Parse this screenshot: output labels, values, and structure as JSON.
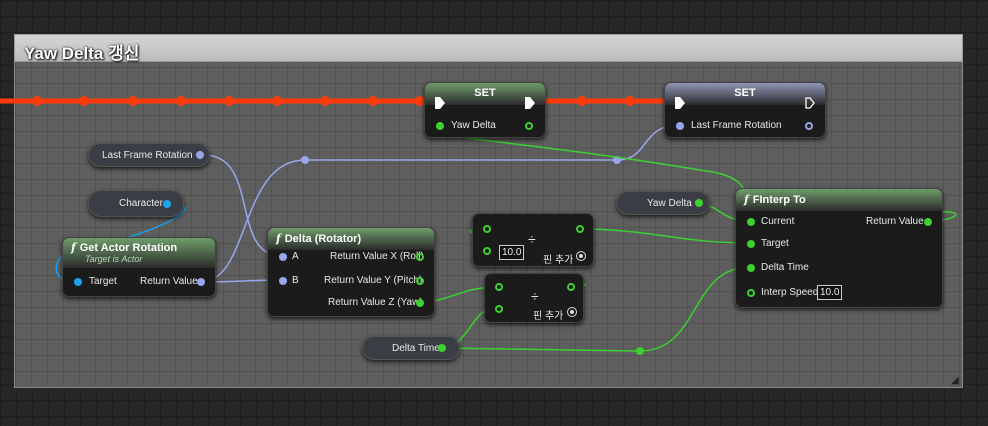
{
  "comment": {
    "title": "Yaw Delta 갱신"
  },
  "colors": {
    "exec_wire": "#ff3a0a",
    "float": "#3bd130",
    "rotator": "#98a6ec",
    "object": "#1aa4f0"
  },
  "set_yaw": {
    "title": "SET",
    "pin": "Yaw Delta"
  },
  "set_last": {
    "title": "SET",
    "pin": "Last Frame Rotation"
  },
  "get_last": {
    "label": "Last Frame Rotation"
  },
  "get_character": {
    "label": "Character"
  },
  "get_yaw": {
    "label": "Yaw Delta"
  },
  "get_delta_time": {
    "label": "Delta Time"
  },
  "actor_rotation": {
    "title": "Get Actor Rotation",
    "subtitle": "Target is Actor",
    "target": "Target",
    "return": "Return Value"
  },
  "delta_rotator": {
    "title": "Delta (Rotator)",
    "a": "A",
    "b": "B",
    "x": "Return Value X (Roll)",
    "y": "Return Value Y (Pitch)",
    "z": "Return Value Z (Yaw)"
  },
  "divide1": {
    "symbol": "÷",
    "value": "10.0",
    "add_pin": "핀 추가"
  },
  "divide2": {
    "symbol": "÷",
    "add_pin": "핀 추가"
  },
  "finterp": {
    "title": "FInterp To",
    "current": "Current",
    "target": "Target",
    "delta_time": "Delta Time",
    "interp_speed": "Interp Speed",
    "interp_value": "10.0",
    "return": "Return Value"
  }
}
